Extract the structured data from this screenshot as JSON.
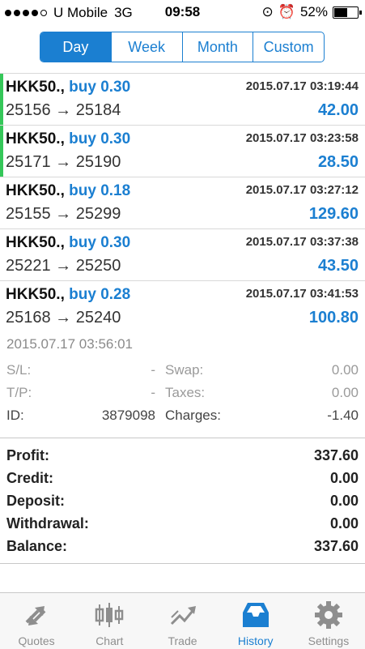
{
  "status_bar": {
    "carrier": "U Mobile",
    "network": "3G",
    "time": "09:58",
    "battery": "52%"
  },
  "period_tabs": [
    "Day",
    "Week",
    "Month",
    "Custom"
  ],
  "selected_period": "Day",
  "trades": [
    {
      "symbol": "HKK50.,",
      "side": "buy 0.30",
      "prices": "25156 → 25184",
      "time": "2015.07.17 03:19:44",
      "profit": "42.00",
      "marked": true
    },
    {
      "symbol": "HKK50.,",
      "side": "buy 0.30",
      "prices": "25171 → 25190",
      "time": "2015.07.17 03:23:58",
      "profit": "28.50",
      "marked": true
    },
    {
      "symbol": "HKK50.,",
      "side": "buy 0.18",
      "prices": "25155 → 25299",
      "time": "2015.07.17 03:27:12",
      "profit": "129.60",
      "marked": false
    },
    {
      "symbol": "HKK50.,",
      "side": "buy 0.30",
      "prices": "25221 → 25250",
      "time": "2015.07.17 03:37:38",
      "profit": "43.50",
      "marked": false
    },
    {
      "symbol": "HKK50.,",
      "side": "buy 0.28",
      "prices": "25168 → 25240",
      "time": "2015.07.17 03:41:53",
      "profit": "100.80",
      "marked": false
    }
  ],
  "detail": {
    "time": "2015.07.17 03:56:01",
    "sl_label": "S/L:",
    "sl_value": "-",
    "swap_label": "Swap:",
    "swap_value": "0.00",
    "tp_label": "T/P:",
    "tp_value": "-",
    "taxes_label": "Taxes:",
    "taxes_value": "0.00",
    "id_label": "ID:",
    "id_value": "3879098",
    "charges_label": "Charges:",
    "charges_value": "-1.40"
  },
  "summary": [
    {
      "label": "Profit:",
      "value": "337.60"
    },
    {
      "label": "Credit:",
      "value": "0.00"
    },
    {
      "label": "Deposit:",
      "value": "0.00"
    },
    {
      "label": "Withdrawal:",
      "value": "0.00"
    },
    {
      "label": "Balance:",
      "value": "337.60"
    }
  ],
  "tab_bar": [
    {
      "label": "Quotes",
      "icon": "quotes-arrows-icon"
    },
    {
      "label": "Chart",
      "icon": "candlestick-chart-icon"
    },
    {
      "label": "Trade",
      "icon": "trade-trend-icon"
    },
    {
      "label": "History",
      "icon": "inbox-history-icon"
    },
    {
      "label": "Settings",
      "icon": "gear-icon"
    }
  ],
  "active_tab": "History",
  "colors": {
    "accent": "#1b7fd1",
    "marker": "#35c759"
  }
}
